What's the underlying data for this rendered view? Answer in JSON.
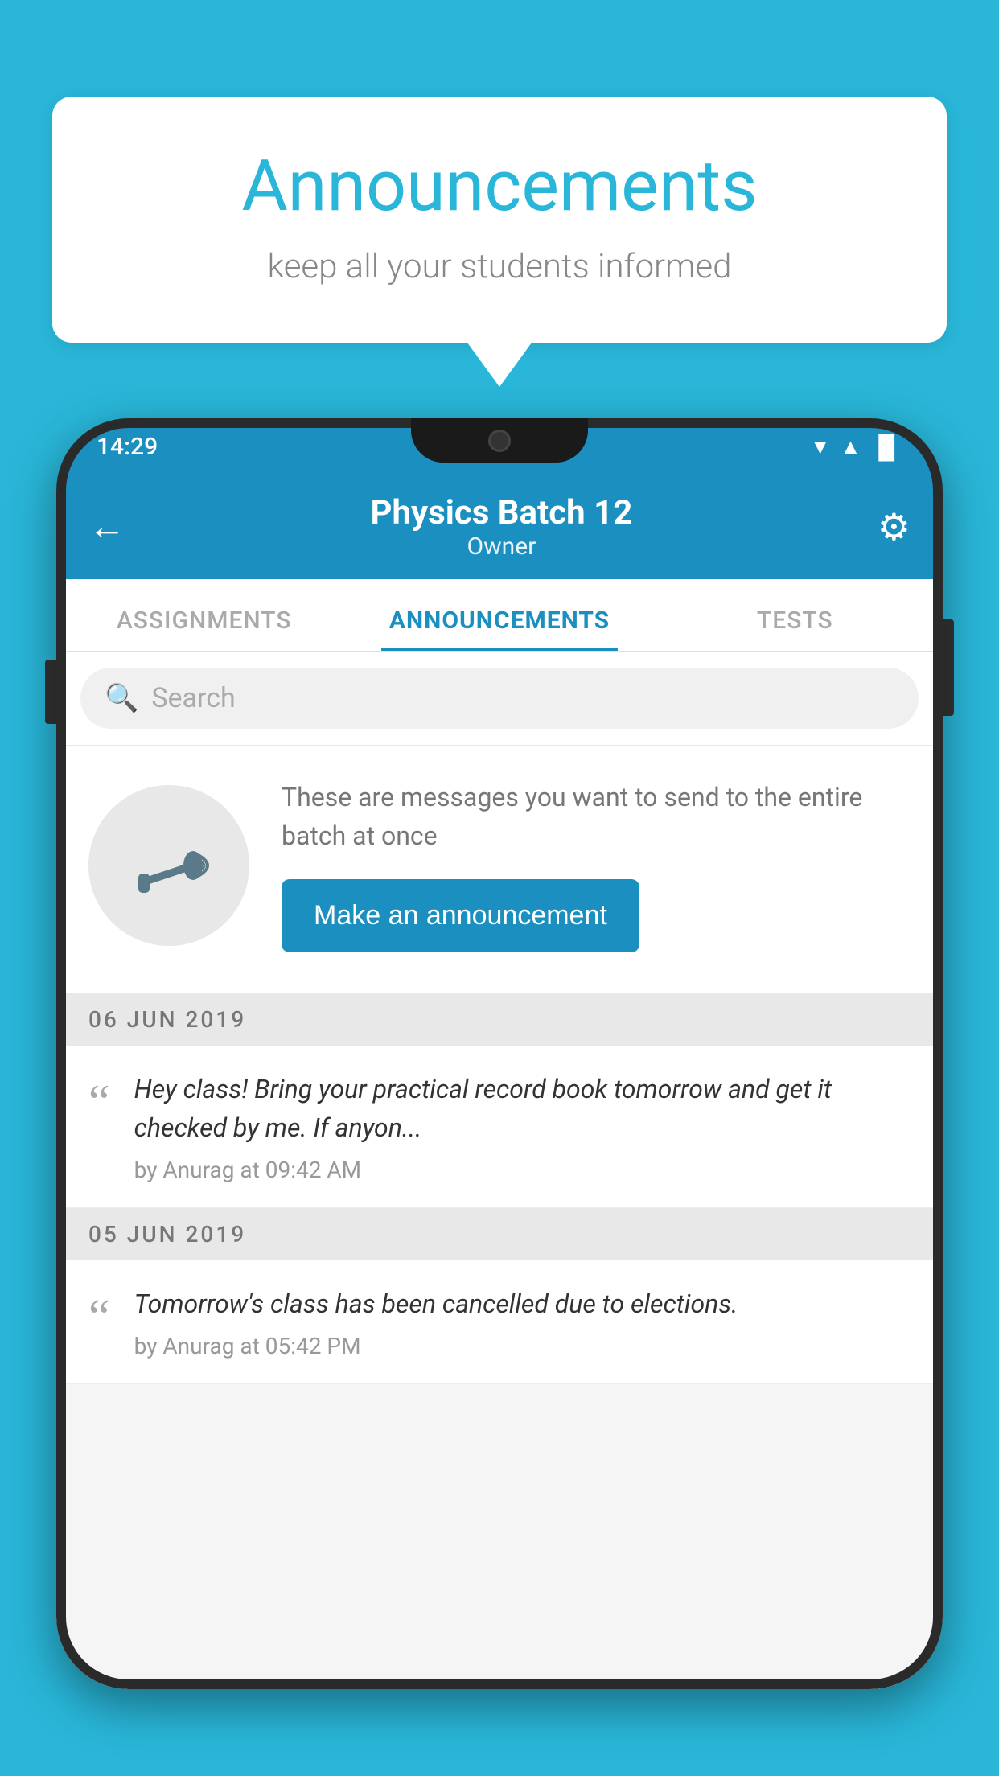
{
  "background_color": "#29b6d8",
  "speech_bubble": {
    "title": "Announcements",
    "subtitle": "keep all your students informed"
  },
  "phone": {
    "status_bar": {
      "time": "14:29",
      "wifi": "▼",
      "signal": "▲",
      "battery": "▐"
    },
    "header": {
      "batch_title": "Physics Batch 12",
      "owner_label": "Owner",
      "back_label": "←",
      "settings_label": "⚙"
    },
    "tabs": [
      {
        "label": "ASSIGNMENTS",
        "active": false
      },
      {
        "label": "ANNOUNCEMENTS",
        "active": true
      },
      {
        "label": "TESTS",
        "active": false
      },
      {
        "label": "...",
        "active": false
      }
    ],
    "search": {
      "placeholder": "Search"
    },
    "promo": {
      "description": "These are messages you want to send to the entire batch at once",
      "button_label": "Make an announcement"
    },
    "announcements": [
      {
        "date": "06  JUN  2019",
        "text": "Hey class! Bring your practical record book tomorrow and get it checked by me. If anyon...",
        "meta": "by Anurag at 09:42 AM"
      },
      {
        "date": "05  JUN  2019",
        "text": "Tomorrow's class has been cancelled due to elections.",
        "meta": "by Anurag at 05:42 PM"
      }
    ]
  }
}
